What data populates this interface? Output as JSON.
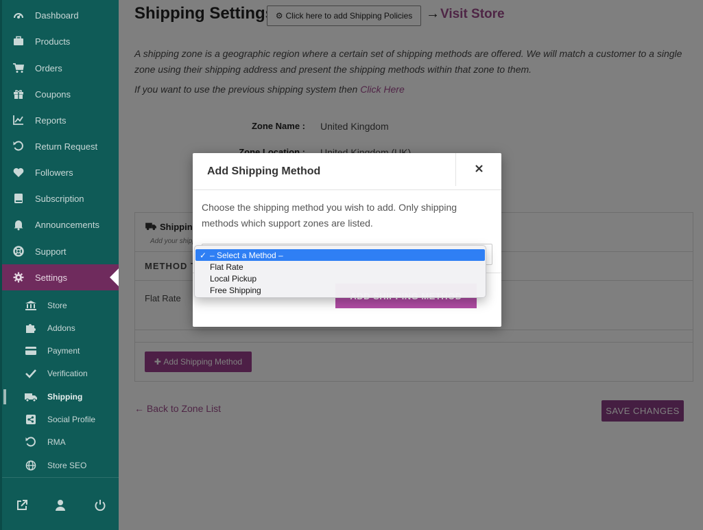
{
  "sidebar": {
    "items": [
      {
        "label": "Dashboard",
        "icon": "dashboard-icon"
      },
      {
        "label": "Products",
        "icon": "briefcase-icon"
      },
      {
        "label": "Orders",
        "icon": "cart-icon"
      },
      {
        "label": "Coupons",
        "icon": "gift-icon"
      },
      {
        "label": "Reports",
        "icon": "chart-line-icon"
      },
      {
        "label": "Return Request",
        "icon": "undo-icon"
      },
      {
        "label": "Followers",
        "icon": "heart-icon"
      },
      {
        "label": "Subscription",
        "icon": "book-icon"
      },
      {
        "label": "Announcements",
        "icon": "bell-icon"
      },
      {
        "label": "Support",
        "icon": "lifebuoy-icon"
      },
      {
        "label": "Settings",
        "icon": "gear-icon"
      }
    ],
    "sub_items": [
      {
        "label": "Store",
        "icon": "university-icon"
      },
      {
        "label": "Addons",
        "icon": "puzzle-icon"
      },
      {
        "label": "Payment",
        "icon": "credit-card-icon"
      },
      {
        "label": "Verification",
        "icon": "check-icon"
      },
      {
        "label": "Shipping",
        "icon": "truck-icon"
      },
      {
        "label": "Social Profile",
        "icon": "share-icon"
      },
      {
        "label": "RMA",
        "icon": "undo-icon"
      },
      {
        "label": "Store SEO",
        "icon": "globe-icon"
      }
    ],
    "footer_icons": [
      "external-link-icon",
      "user-icon",
      "power-icon"
    ],
    "colors": {
      "background": "#0f5b57",
      "active": "#6f2b5d"
    }
  },
  "page": {
    "title": "Shipping Settings",
    "policies_button": "Click here to add Shipping Policies",
    "arrow": "→",
    "visit_store": "Visit Store",
    "intro": "A shipping zone is a geographic region where a certain set of shipping methods are offered. We will match a customer to a single zone using their shipping address and present the shipping methods within that zone to them.",
    "prev_text": "If you want to use the previous shipping system then",
    "prev_link": "Click Here",
    "zone_name_label": "Zone Name :",
    "zone_name_value": "United Kingdom",
    "zone_location_label": "Zone Location :",
    "zone_location_value": "United Kingdom (UK)",
    "shipping_heading": "Shipping Method",
    "shipping_sub": "Add your shipping method for appropriate zone",
    "method_column": "METHOD TITLE",
    "flat_rate_row": "Flat Rate",
    "add_method_button": "Add Shipping Method",
    "back_link": "← Back to Zone List",
    "save_button": "SAVE CHANGES",
    "accent_color": "#9d4b8b"
  },
  "modal": {
    "title": "Add Shipping Method",
    "close": "×",
    "description": "Choose the shipping method you wish to add. Only shipping methods which support zones are listed.",
    "add_button": "ADD SHIPPING METHOD",
    "button_color": "#b24da6"
  },
  "dropdown": {
    "selected_index": 0,
    "options": [
      "– Select a Method –",
      "Flat Rate",
      "Local Pickup",
      "Free Shipping"
    ],
    "highlight_color": "#2f7ff4"
  }
}
